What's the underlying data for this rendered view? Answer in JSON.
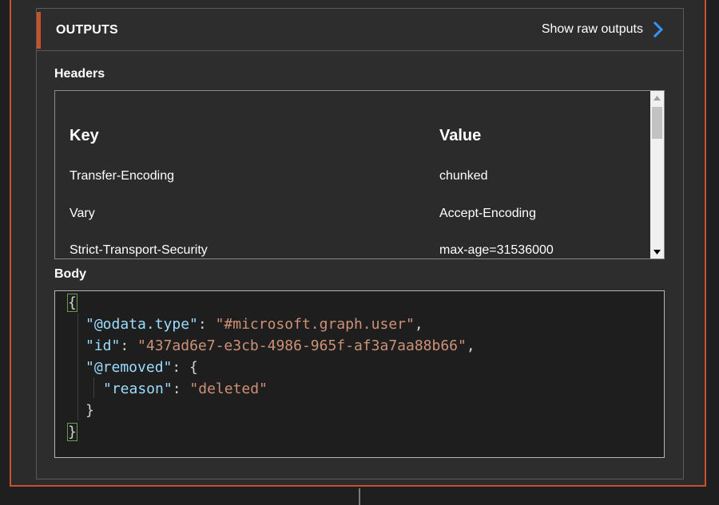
{
  "outputs": {
    "title": "OUTPUTS",
    "show_raw_label": "Show raw outputs",
    "headers_label": "Headers",
    "body_label": "Body",
    "headers_table": {
      "columns": [
        "Key",
        "Value"
      ],
      "rows": [
        {
          "key": "Transfer-Encoding",
          "value": "chunked"
        },
        {
          "key": "Vary",
          "value": "Accept-Encoding"
        },
        {
          "key": "Strict-Transport-Security",
          "value": "max-age=31536000"
        }
      ]
    },
    "body_json": {
      "odata_type_key": "\"@odata.type\"",
      "odata_type_value": "\"#microsoft.graph.user\"",
      "id_key": "\"id\"",
      "id_value": "\"437ad6e7-e3cb-4986-965f-af3a7aa88b66\"",
      "removed_key": "\"@removed\"",
      "reason_key": "\"reason\"",
      "reason_value": "\"deleted\""
    }
  },
  "colors": {
    "accent": "#c8502a",
    "link_chevron": "#3794ff",
    "json_key": "#9cdcfe",
    "json_string": "#ce9178"
  }
}
